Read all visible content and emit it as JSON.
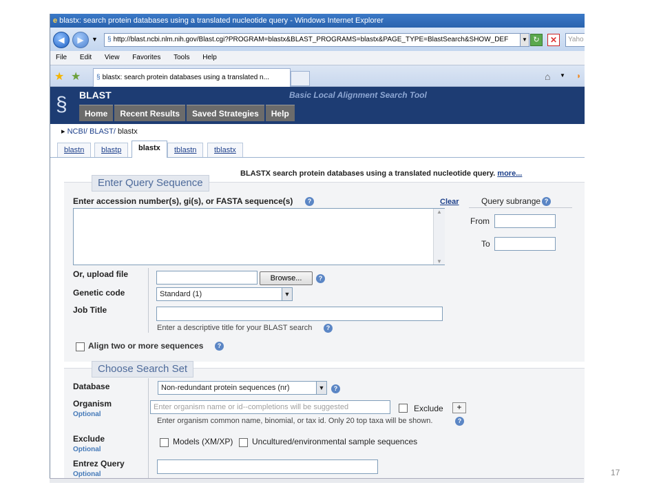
{
  "browser": {
    "window_title": "blastx: search protein databases using a translated nucleotide query - Windows Internet Explorer",
    "address": "http://blast.ncbi.nlm.nih.gov/Blast.cgi?PROGRAM=blastx&BLAST_PROGRAMS=blastx&PAGE_TYPE=BlastSearch&SHOW_DEF",
    "search_placeholder": "Yaho",
    "menu": [
      "File",
      "Edit",
      "View",
      "Favorites",
      "Tools",
      "Help"
    ],
    "tab_title": "blastx: search protein databases using a translated n..."
  },
  "blast": {
    "title": "BLAST",
    "subtitle": "Basic Local Alignment Search Tool",
    "nav": [
      "Home",
      "Recent Results",
      "Saved Strategies",
      "Help"
    ]
  },
  "breadcrumb": {
    "ncbi": "NCBI/",
    "blast": "BLAST/",
    "current": "blastx"
  },
  "program_tabs": [
    "blastn",
    "blastp",
    "blastx",
    "tblastn",
    "tblastx"
  ],
  "program_desc": {
    "text": "BLASTX search protein databases using a translated nucleotide query.",
    "more": "more..."
  },
  "query": {
    "legend": "Enter Query Sequence",
    "accession_label": "Enter accession number(s), gi(s), or FASTA sequence(s)",
    "clear": "Clear",
    "subrange_label": "Query subrange",
    "from_label": "From",
    "to_label": "To",
    "upload_label": "Or, upload file",
    "browse_label": "Browse...",
    "genetic_code_label": "Genetic code",
    "genetic_code_value": "Standard (1)",
    "job_title_label": "Job Title",
    "job_title_hint": "Enter a descriptive title for your BLAST search",
    "align_label": "Align two or more sequences"
  },
  "search_set": {
    "legend": "Choose Search Set",
    "database_label": "Database",
    "database_value": "Non-redundant protein sequences (nr)",
    "organism_label": "Organism",
    "optional": "Optional",
    "organism_placeholder": "Enter organism name or id--completions will be suggested",
    "exclude_check_label": "Exclude",
    "organism_hint": "Enter organism common name, binomial, or tax id. Only 20 top taxa will be shown.",
    "exclude_label": "Exclude",
    "models_label": "Models (XM/XP)",
    "uncultured_label": "Uncultured/environmental sample sequences",
    "entrez_label": "Entrez Query"
  },
  "slide_number": "17"
}
